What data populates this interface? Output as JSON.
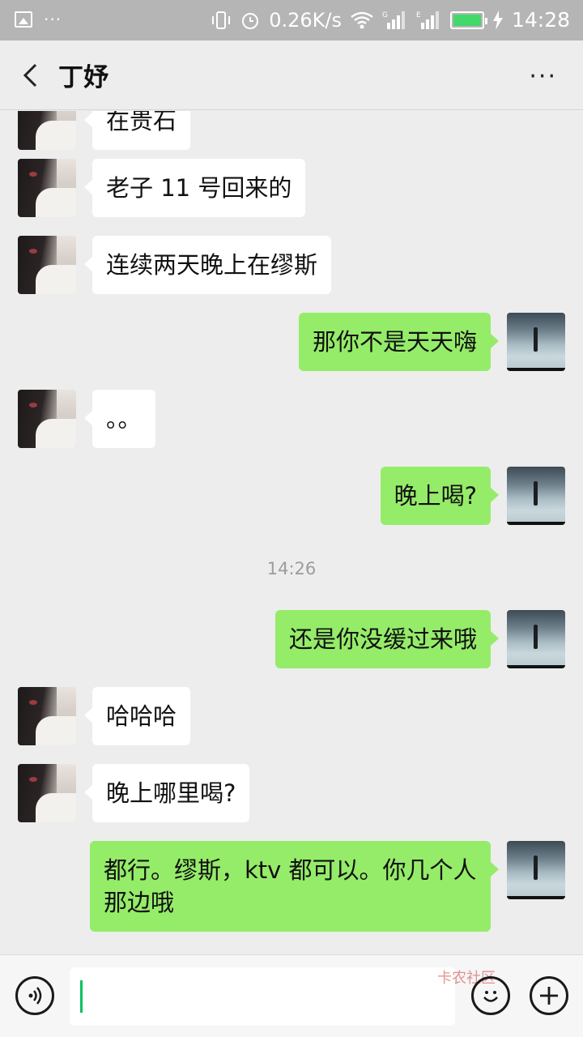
{
  "status_bar": {
    "left_dots": "···",
    "net_speed": "0.26K/s",
    "sim1_label": "G",
    "sim2_label": "E",
    "time": "14:28",
    "battery_color": "#43d86a"
  },
  "header": {
    "title": "丁妤",
    "more_label": "···"
  },
  "messages": [
    {
      "side": "her",
      "text": "在贵石"
    },
    {
      "side": "her",
      "text": "老子 11 号回来的"
    },
    {
      "side": "her",
      "text": "连续两天晚上在缪斯"
    },
    {
      "side": "me",
      "text": "那你不是天天嗨"
    },
    {
      "side": "her",
      "text": "。。"
    },
    {
      "side": "me",
      "text": "晚上喝?"
    },
    {
      "side": "me",
      "text": "还是你没缓过来哦"
    },
    {
      "side": "her",
      "text": "哈哈哈"
    },
    {
      "side": "her",
      "text": "晚上哪里喝?"
    },
    {
      "side": "me",
      "text": "都行。缪斯，ktv 都可以。你几个人那边哦"
    }
  ],
  "timestamp": "14:26",
  "input": {
    "value": "",
    "watermark": "卡农社区"
  },
  "colors": {
    "my_bubble": "#95ec69",
    "her_bubble": "#ffffff",
    "background": "#ededed",
    "cursor": "#07c160"
  },
  "icons": {
    "back": "chevron-left-icon",
    "more": "more-dots-icon",
    "voice": "voice-icon",
    "emoji": "emoji-icon",
    "plus": "plus-icon"
  }
}
